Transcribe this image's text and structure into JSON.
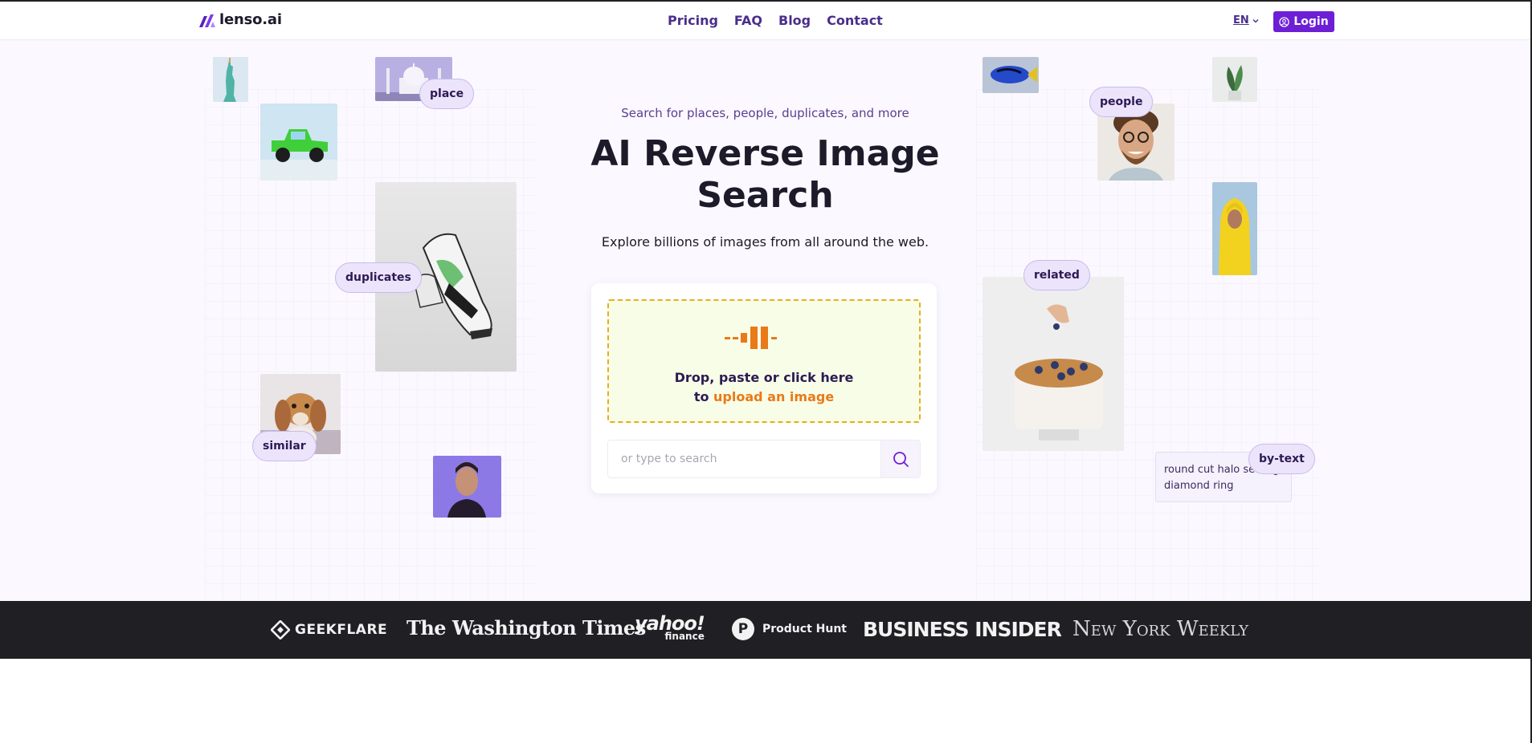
{
  "header": {
    "brand": "lenso.ai",
    "nav": [
      {
        "label": "Pricing"
      },
      {
        "label": "FAQ"
      },
      {
        "label": "Blog"
      },
      {
        "label": "Contact"
      }
    ],
    "language": "EN",
    "login_label": "Login"
  },
  "hero": {
    "subtitle": "Search for places, people, duplicates, and more",
    "title": "AI Reverse Image Search",
    "lead": "Explore billions of images from all around the web.",
    "drop_line1": "Drop, paste or click here",
    "drop_line2_prefix": "to",
    "drop_line2_link": "upload an image",
    "search_placeholder": "or type to search"
  },
  "tags": {
    "place": "place",
    "duplicates": "duplicates",
    "similar": "similar",
    "people": "people",
    "related": "related",
    "by_text": "by-text"
  },
  "by_text_example": "round cut halo setting diamond ring",
  "press": {
    "geekflare": "GEEKFLARE",
    "washington_times": "The Washington Times",
    "yahoo": "yahoo!",
    "yahoo_sub": "finance",
    "product_hunt": "Product Hunt",
    "product_hunt_letter": "P",
    "business_insider": "BUSINESS INSIDER",
    "new_york_weekly": "New York Weekly"
  },
  "colors": {
    "brand_purple": "#6d1fd6",
    "nav_purple": "#4a2e8c",
    "upload_accent": "#e97a17",
    "drop_border": "#e3b11b",
    "press_bar": "#1f1f24"
  }
}
